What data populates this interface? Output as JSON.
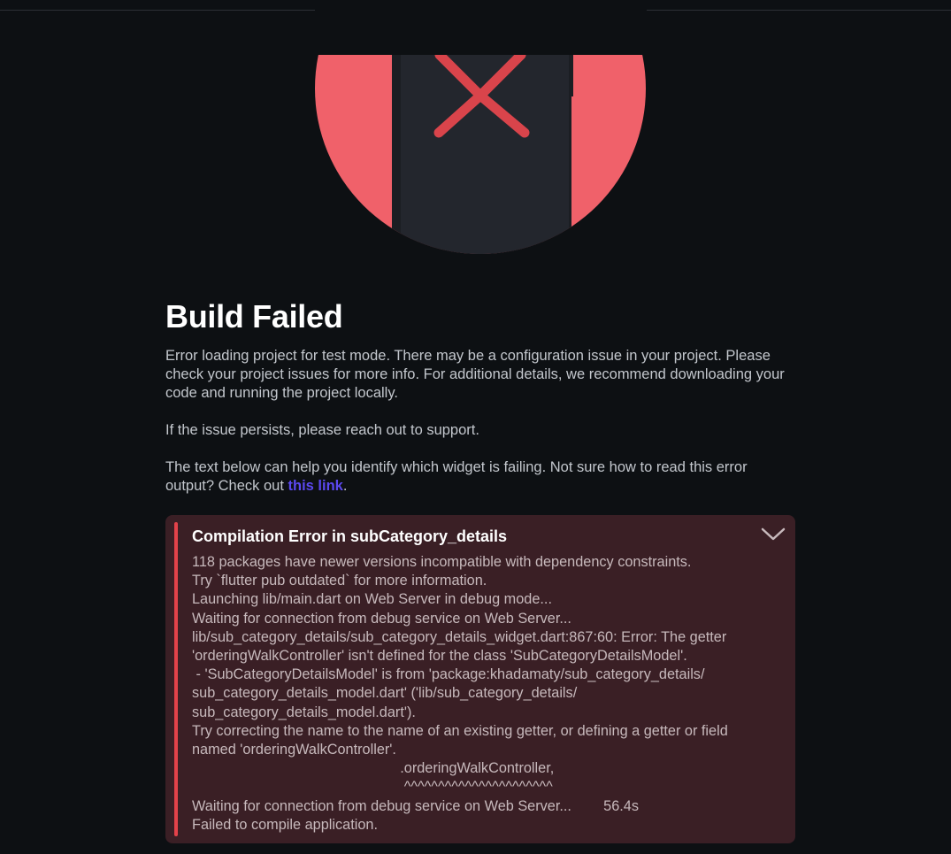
{
  "hero": {
    "icon": "phone-with-x-icon",
    "circle_color": "#f0616a",
    "phone_color": "#21252c",
    "x_color": "#d9444b"
  },
  "page": {
    "title": "Build Failed",
    "paragraph1": "Error loading project for test mode. There may be a configuration issue in your project. Please check your project issues for more info. For additional details, we recommend downloading your code and running the project locally.",
    "paragraph2": "If the issue persists, please reach out to support.",
    "paragraph3_prefix": "The text below can help you identify which widget is failing. Not sure how to read this error output? Check out ",
    "paragraph3_link": "this link",
    "paragraph3_suffix": "."
  },
  "error": {
    "title": "Compilation Error in subCategory_details",
    "toggle_icon": "chevron-down-icon",
    "accent_color": "#e3424a",
    "log": "118 packages have newer versions incompatible with dependency constraints.\nTry `flutter pub outdated` for more information.\nLaunching lib/main.dart on Web Server in debug mode...\nWaiting for connection from debug service on Web Server...\nlib/sub_category_details/sub_category_details_widget.dart:867:60: Error: The getter\n'orderingWalkController' isn't defined for the class 'SubCategoryDetailsModel'.\n - 'SubCategoryDetailsModel' is from 'package:khadamaty/sub_category_details/\nsub_category_details_model.dart' ('lib/sub_category_details/\nsub_category_details_model.dart').\nTry correcting the name to the name of an existing getter, or defining a getter or field\nnamed 'orderingWalkController'.\n                                                    .orderingWalkController,\n                                                     ^^^^^^^^^^^^^^^^^^^^^^\nWaiting for connection from debug service on Web Server...        56.4s\nFailed to compile application."
  }
}
